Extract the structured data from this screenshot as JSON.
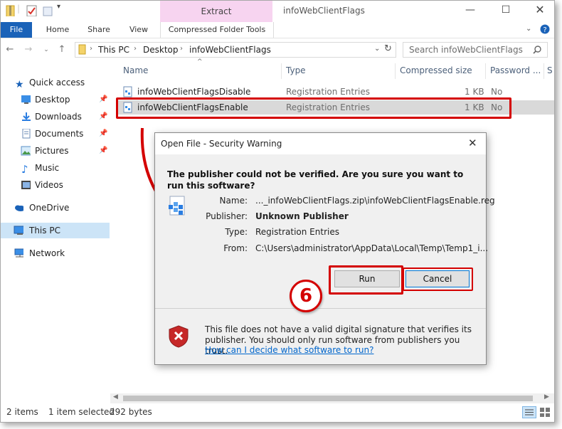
{
  "window": {
    "title": "infoWebClientFlags",
    "context_tab": "Extract"
  },
  "ribbon": {
    "tabs": [
      "File",
      "Home",
      "Share",
      "View",
      "Compressed Folder Tools"
    ]
  },
  "address": {
    "crumbs": [
      "This PC",
      "Desktop",
      "infoWebClientFlags"
    ],
    "search_placeholder": "Search infoWebClientFlags"
  },
  "nav": {
    "quick_access": "Quick access",
    "items": [
      {
        "label": "Desktop",
        "icon": "desktop-icon",
        "pinned": true
      },
      {
        "label": "Downloads",
        "icon": "downloads-icon",
        "pinned": true
      },
      {
        "label": "Documents",
        "icon": "documents-icon",
        "pinned": true
      },
      {
        "label": "Pictures",
        "icon": "pictures-icon",
        "pinned": true
      },
      {
        "label": "Music",
        "icon": "music-icon",
        "pinned": false
      },
      {
        "label": "Videos",
        "icon": "videos-icon",
        "pinned": false
      }
    ],
    "onedrive": "OneDrive",
    "thispc": "This PC",
    "network": "Network"
  },
  "columns": [
    "Name",
    "Type",
    "Compressed size",
    "Password ...",
    "S"
  ],
  "files": [
    {
      "name": "infoWebClientFlagsDisable",
      "type": "Registration Entries",
      "size": "1 KB",
      "password": "No"
    },
    {
      "name": "infoWebClientFlagsEnable",
      "type": "Registration Entries",
      "size": "1 KB",
      "password": "No"
    }
  ],
  "status": {
    "items": "2 items",
    "selected": "1 item selected",
    "size": "292 bytes"
  },
  "dialog": {
    "title": "Open File - Security Warning",
    "question": "The publisher could not be verified.  Are you sure you want to run this software?",
    "fields": [
      {
        "label": "Name:",
        "value": "..._infoWebClientFlags.zip\\infoWebClientFlagsEnable.reg",
        "bold": false
      },
      {
        "label": "Publisher:",
        "value": "Unknown Publisher",
        "bold": true
      },
      {
        "label": "Type:",
        "value": "Registration Entries",
        "bold": false
      },
      {
        "label": "From:",
        "value": "C:\\Users\\administrator\\AppData\\Local\\Temp\\Temp1_i...",
        "bold": false
      }
    ],
    "run_label": "Run",
    "cancel_label": "Cancel",
    "warning_text": "This file does not have a valid digital signature that verifies its publisher.  You should only run software from publishers you trust.",
    "link": "How can I decide what software to run?"
  },
  "annotation": {
    "step": "6",
    "color": "#d40000"
  }
}
